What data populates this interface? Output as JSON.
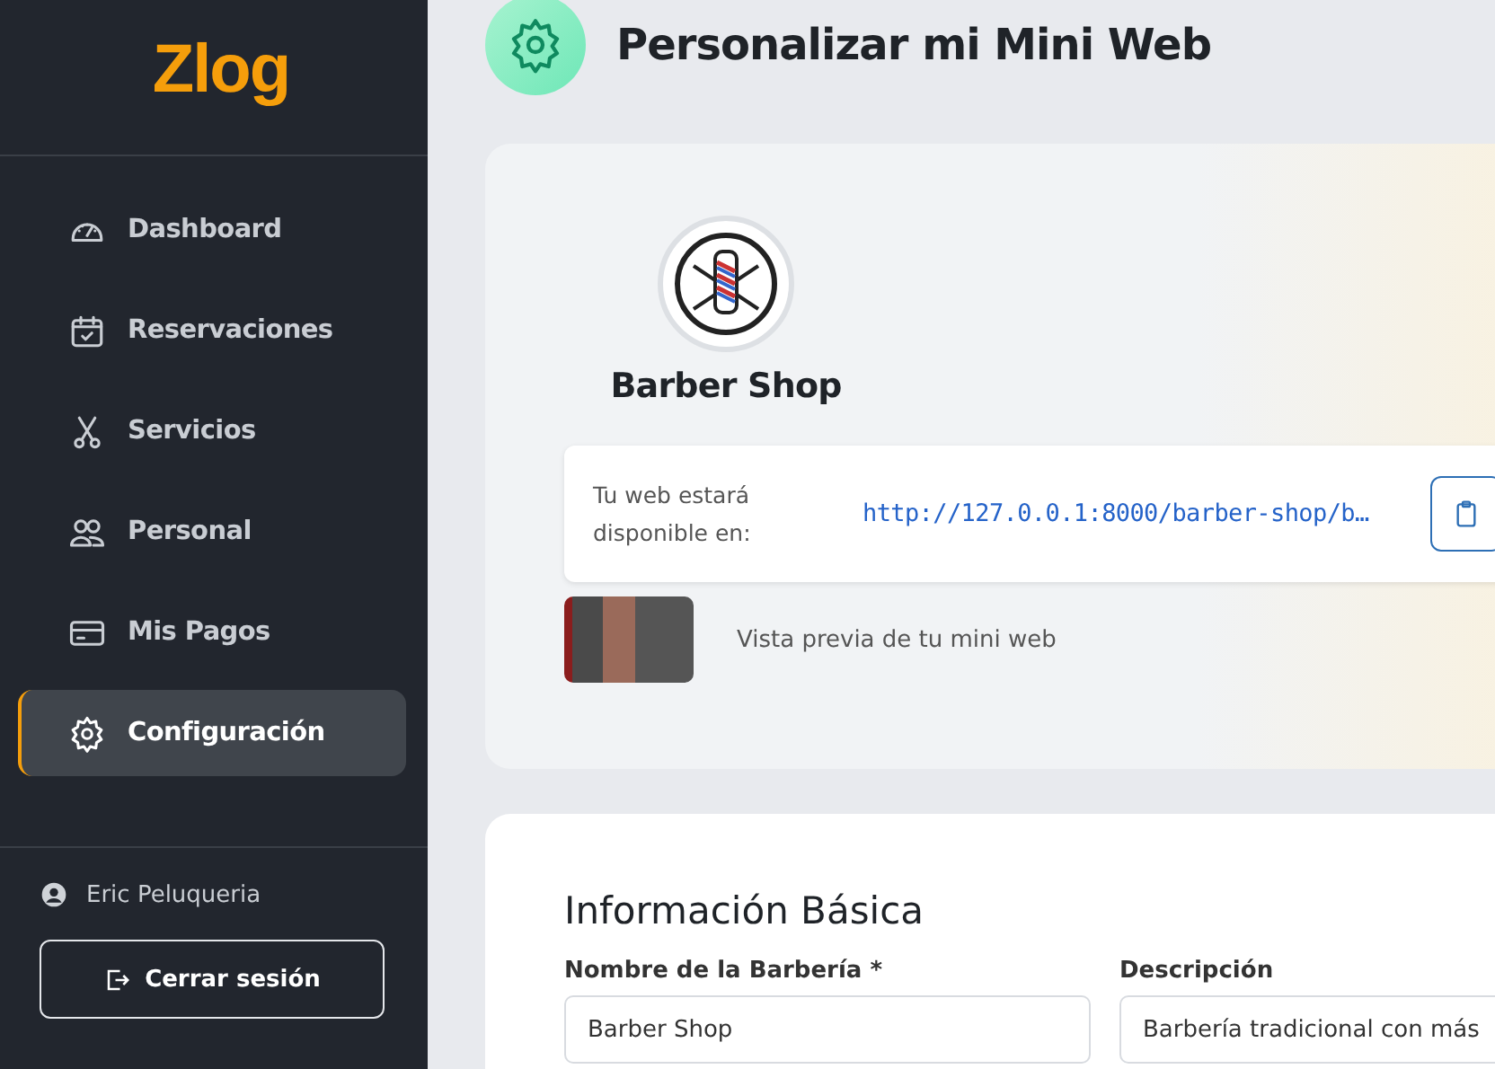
{
  "sidebar": {
    "logo": "Zlog",
    "items": [
      {
        "label": "Dashboard",
        "selected": false
      },
      {
        "label": "Reservaciones",
        "selected": false
      },
      {
        "label": "Servicios",
        "selected": false
      },
      {
        "label": "Personal",
        "selected": false
      },
      {
        "label": "Mis Pagos",
        "selected": false
      },
      {
        "label": "Configuración",
        "selected": true
      }
    ],
    "user": "Eric Peluqueria",
    "logout": "Cerrar sesión"
  },
  "header": {
    "title": "Personalizar mi Mini Web"
  },
  "preview": {
    "name": "Barber Shop",
    "url_label": "Tu web estará disponible en:",
    "url": "http://127.0.0.1:8000/barber-shop/b…",
    "preview_caption": "Vista previa de tu mini web"
  },
  "basic_info": {
    "title": "Información Básica",
    "fields": [
      {
        "label": "Nombre de la Barbería *",
        "value": "Barber Shop"
      },
      {
        "label": "Descripción",
        "value": "Barbería tradicional con más"
      }
    ]
  }
}
